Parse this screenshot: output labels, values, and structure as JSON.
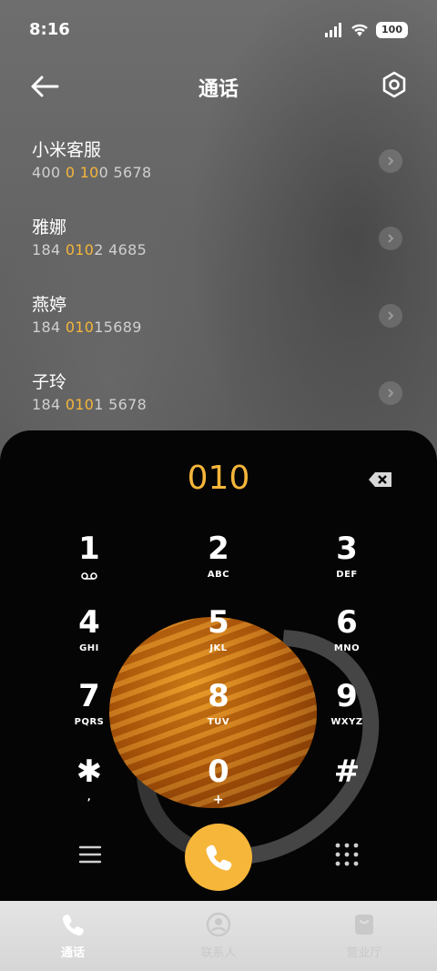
{
  "status_bar": {
    "time": "8:16",
    "battery": "100"
  },
  "header": {
    "title": "通话",
    "back_icon": "arrow-left-icon",
    "settings_icon": "settings-hexagon-icon"
  },
  "contacts": [
    {
      "name": "小米客服",
      "number_parts": [
        "400 ",
        "0",
        " ",
        "10",
        "0 5678"
      ]
    },
    {
      "name": "雅娜",
      "number_parts": [
        "184 ",
        "010",
        "2 4685",
        "",
        ""
      ]
    },
    {
      "name": "燕婷",
      "number_parts": [
        "184 ",
        "010",
        "15689",
        "",
        ""
      ]
    },
    {
      "name": "子玲",
      "number_parts": [
        "184 ",
        "010",
        "1 5678",
        "",
        ""
      ]
    }
  ],
  "dialer": {
    "dialed": "010",
    "keys": [
      {
        "digit": "1",
        "letters": ""
      },
      {
        "digit": "2",
        "letters": "ABC"
      },
      {
        "digit": "3",
        "letters": "DEF"
      },
      {
        "digit": "4",
        "letters": "GHI"
      },
      {
        "digit": "5",
        "letters": "JKL"
      },
      {
        "digit": "6",
        "letters": "MNO"
      },
      {
        "digit": "7",
        "letters": "PQRS"
      },
      {
        "digit": "8",
        "letters": "TUV"
      },
      {
        "digit": "9",
        "letters": "WXYZ"
      },
      {
        "digit": "✱",
        "letters": ","
      },
      {
        "digit": "0",
        "letters": "+"
      },
      {
        "digit": "#",
        "letters": ""
      }
    ]
  },
  "nav": [
    {
      "label": "通话",
      "icon": "phone-icon"
    },
    {
      "label": "联系人",
      "icon": "contact-icon"
    },
    {
      "label": "营业厅",
      "icon": "shopping-bag-icon"
    }
  ],
  "colors": {
    "accent": "#f5b63a",
    "dialer_bg": "#050505"
  }
}
